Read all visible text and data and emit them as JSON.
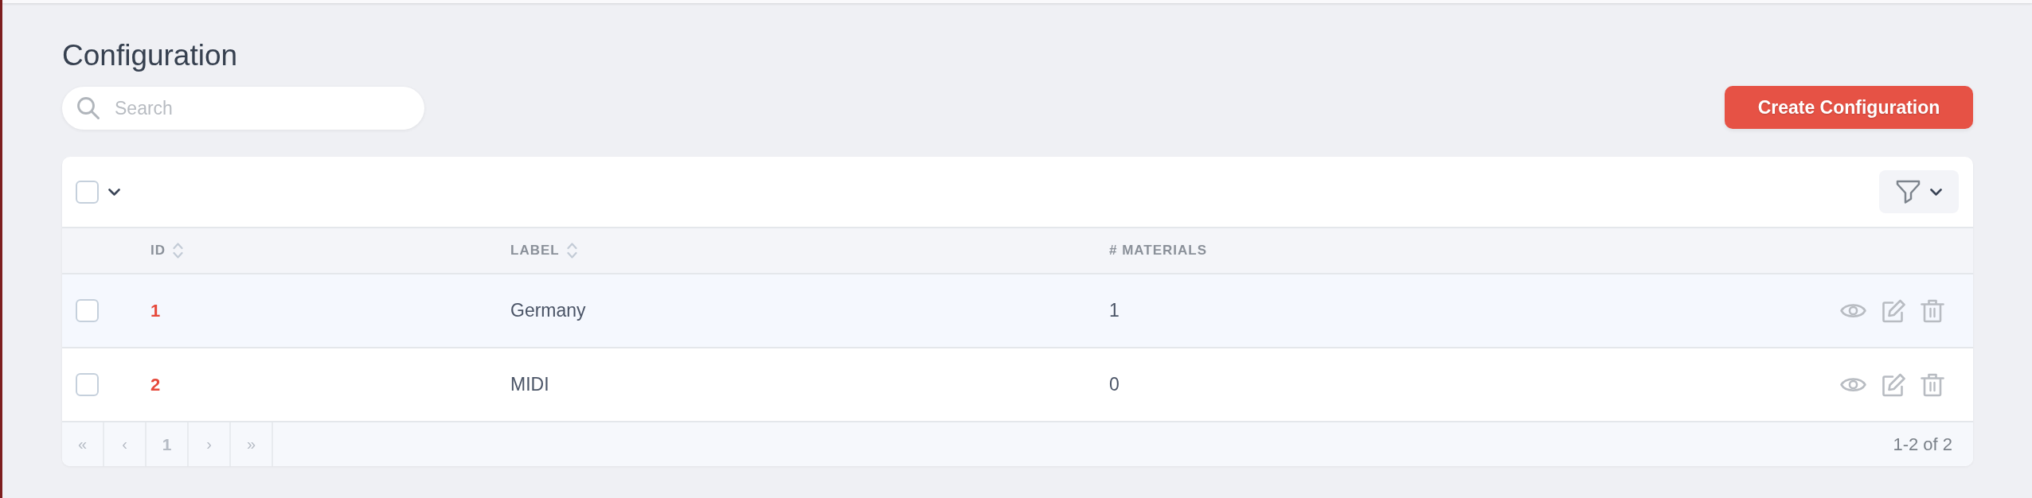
{
  "page": {
    "title": "Configuration"
  },
  "search": {
    "placeholder": "Search"
  },
  "create_button": {
    "label": "Create Configuration"
  },
  "table": {
    "select_all": {
      "checked": false
    },
    "columns": [
      {
        "label": "ID",
        "sortable": true
      },
      {
        "label": "LABEL",
        "sortable": true
      },
      {
        "label": "# MATERIALS",
        "sortable": false
      }
    ],
    "rows": [
      {
        "id": "1",
        "label": "Germany",
        "materials": "1",
        "checked": false
      },
      {
        "id": "2",
        "label": "MIDI",
        "materials": "0",
        "checked": false
      }
    ]
  },
  "pagination": {
    "buttons": [
      {
        "label": "«",
        "kind": "arrow"
      },
      {
        "label": "‹",
        "kind": "arrow"
      },
      {
        "label": "1",
        "kind": "page"
      },
      {
        "label": "›",
        "kind": "arrow"
      },
      {
        "label": "»",
        "kind": "arrow"
      }
    ],
    "summary": "1-2 of 2"
  }
}
